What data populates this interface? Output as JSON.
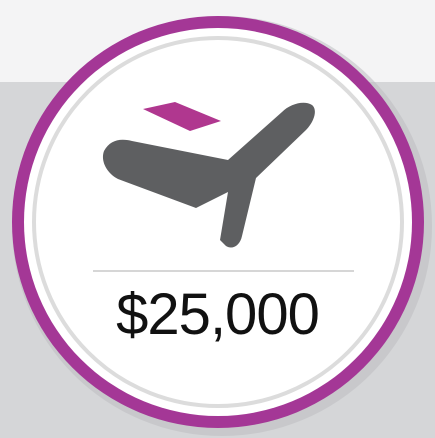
{
  "badge": {
    "icon": "airplane-icon",
    "amount": "$25,000"
  },
  "colors": {
    "ring": "#a43796",
    "plane_body": "#5e5f61",
    "plane_tail": "#b0378f",
    "background_top": "#f4f4f5",
    "background_band": "#d5d6d8",
    "inner_ring": "#dcdcdc",
    "divider": "#d6d6d6",
    "amount_text": "#111111"
  }
}
